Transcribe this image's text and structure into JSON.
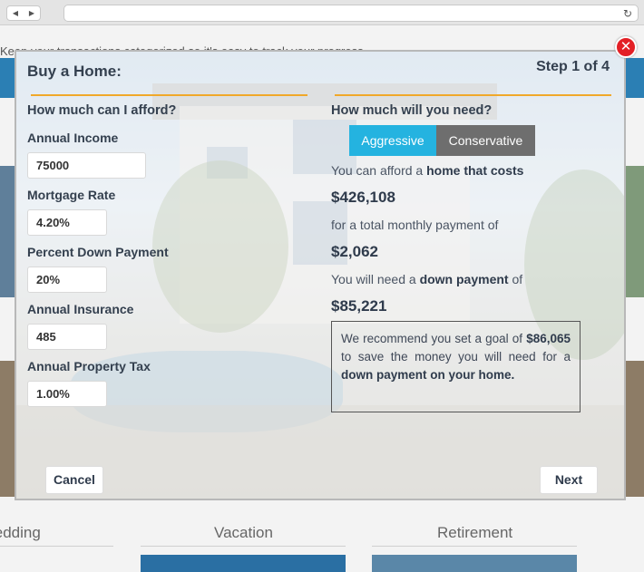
{
  "browser": {
    "back_label": "◀",
    "forward_label": "▶",
    "reload_label": "↻"
  },
  "background": {
    "intro_text": "Keep your transactions categorized so it's easy to track your progress.",
    "categories": [
      "Wedding",
      "Vacation",
      "Retirement"
    ]
  },
  "modal": {
    "title": "Buy a Home:",
    "step": "Step 1 of 4",
    "close_label": "✕",
    "left": {
      "heading": "How much can I afford?",
      "fields": [
        {
          "label": "Annual Income",
          "value": "75000"
        },
        {
          "label": "Mortgage Rate",
          "value": "4.20%"
        },
        {
          "label": "Percent Down Payment",
          "value": "20%"
        },
        {
          "label": "Annual Insurance",
          "value": "485"
        },
        {
          "label": "Annual Property Tax",
          "value": "1.00%"
        }
      ]
    },
    "right": {
      "heading": "How much will you need?",
      "toggle": {
        "aggressive": "Aggressive",
        "conservative": "Conservative",
        "selected": "Aggressive"
      },
      "afford_prefix": "You can afford a ",
      "afford_emph": "home that costs",
      "home_cost": "$426,108",
      "monthly_text": "for a total monthly payment of",
      "monthly_payment": "$2,062",
      "down_prefix": "You will need a ",
      "down_emph": "down payment",
      "down_suffix": " of",
      "down_payment": "$85,221",
      "recommend": {
        "part1": "We recommend you set a goal of ",
        "goal": "$86,065",
        "part2": " to save the money you will need for a ",
        "emph": "down payment on your home."
      }
    },
    "buttons": {
      "cancel": "Cancel",
      "next": "Next"
    }
  }
}
